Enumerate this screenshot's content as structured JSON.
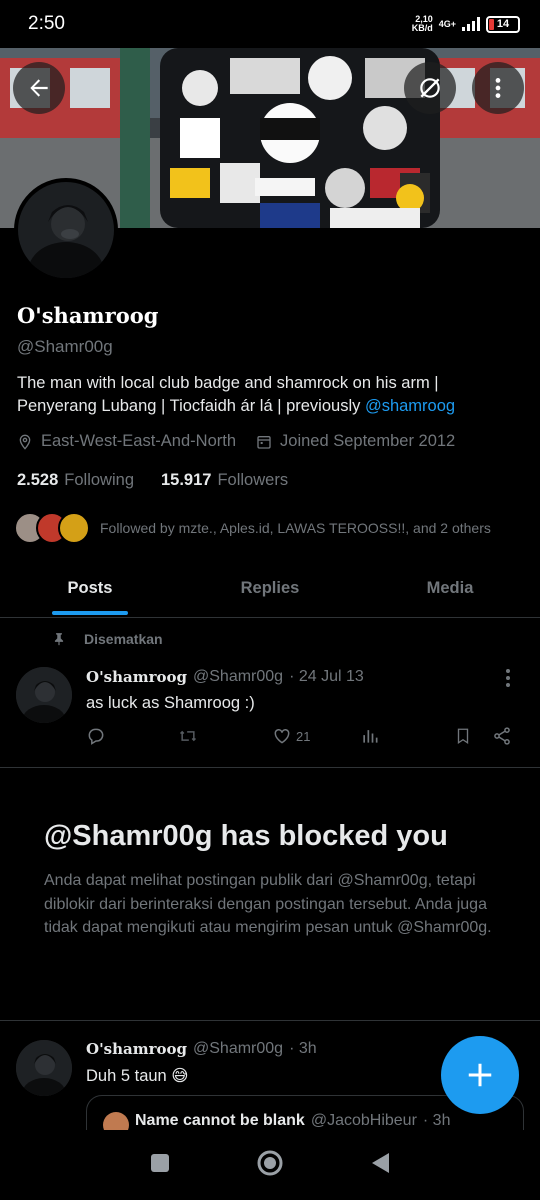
{
  "status_bar": {
    "time": "2:50",
    "net_speed_top": "2,10",
    "net_speed_bottom": "KB/d",
    "network": "4G+",
    "battery": "14"
  },
  "header": {
    "back_icon": "back-arrow-icon",
    "grok_icon": "grok-icon",
    "more_icon": "more-vertical-icon"
  },
  "profile": {
    "display_name": "O'shamroog",
    "handle": "@Shamr00g",
    "bio_text": "The man with local club badge and shamrock on his arm | Penyerang Lubang | Tiocfaidh ár lá | previously ",
    "bio_mention": "@shamroog",
    "location": "East-West-East-And-North",
    "joined": "Joined September 2012",
    "following_count": "2.528",
    "following_label": "Following",
    "followers_count": "15.917",
    "followers_label": "Followers",
    "followed_by": "Followed by mzte., Aples.id, LAWAS TEROOSS!!, and 2 others"
  },
  "tabs": [
    {
      "label": "Posts",
      "active": true
    },
    {
      "label": "Replies",
      "active": false
    },
    {
      "label": "Media",
      "active": false
    }
  ],
  "pinned_tweet": {
    "pinned_label": "Disematkan",
    "name": "O'shamroog",
    "handle": "@Shamr00g",
    "time": "· 24 Jul 13",
    "text": "as luck as Shamroog :)",
    "likes": "21"
  },
  "blocked": {
    "title": "@Shamr00g has blocked you",
    "description": "Anda dapat melihat postingan publik dari @Shamr00g, tetapi diblokir dari berinteraksi dengan postingan tersebut. Anda juga tidak dapat mengikuti atau mengirim pesan untuk @Shamr00g."
  },
  "second_tweet": {
    "name": "O'shamroog",
    "handle": "@Shamr00g",
    "time": "· 3h",
    "text": "Duh 5 taun 😅",
    "quote_name": "Name cannot be blank",
    "quote_handle": "@JacobHibeur",
    "quote_time": "· 3h"
  },
  "colors": {
    "accent": "#1d9bf0",
    "background": "#000000",
    "muted_text": "#71767b",
    "divider": "#2f3336"
  }
}
